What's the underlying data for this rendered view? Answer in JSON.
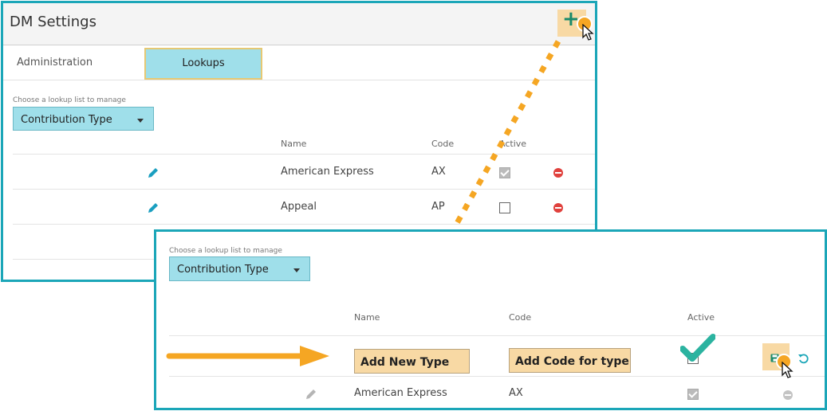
{
  "settings": {
    "title": "DM Settings",
    "tabs": [
      {
        "label": "Administration",
        "active": false
      },
      {
        "label": "Lookups",
        "active": true
      }
    ],
    "add_icon": "plus-icon"
  },
  "lookup": {
    "label": "Choose a lookup list to manage",
    "selected": "Contribution Type"
  },
  "table": {
    "columns": {
      "name": "Name",
      "code": "Code",
      "active": "Active"
    },
    "rows": [
      {
        "name": "American Express",
        "code": "AX",
        "active": true
      },
      {
        "name": "Appeal",
        "code": "AP",
        "active": false
      }
    ]
  },
  "detail": {
    "lookup_label": "Choose a lookup list to manage",
    "lookup_selected": "Contribution Type",
    "columns": {
      "name": "Name",
      "code": "Code",
      "active": "Active"
    },
    "new_row": {
      "name_placeholder": "Add New Type",
      "code_placeholder": "Add Code for type",
      "active": false
    },
    "rows": [
      {
        "name": "American Express",
        "code": "AX",
        "active": true
      }
    ]
  },
  "colors": {
    "accent_border": "#1ba6b8",
    "selection_fill": "#9fdfea",
    "highlight": "#f8d9a4",
    "callout": "#f5a623",
    "check_teal": "#2bb3a0",
    "delete_red": "#e0413d"
  }
}
